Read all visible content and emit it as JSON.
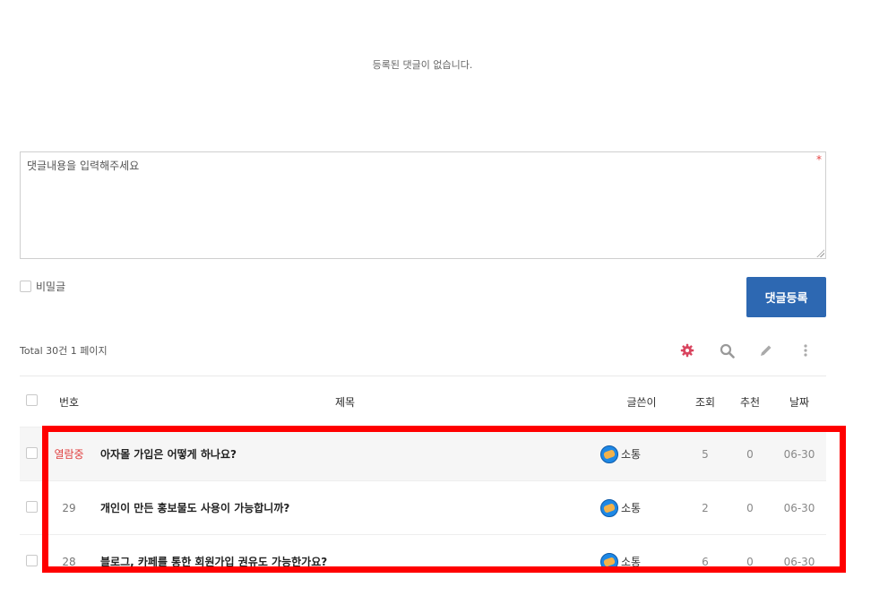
{
  "comments": {
    "empty_message": "등록된 댓글이 없습니다.",
    "input_placeholder": "댓글내용을 입력해주세요",
    "required_mark": "*",
    "secret_label": "비밀글",
    "submit_label": "댓글등록"
  },
  "board": {
    "total_text": "Total 30건 1 페이지",
    "toolbar_icons": [
      "gear-icon",
      "search-icon",
      "pencil-icon",
      "more-vertical-icon"
    ],
    "accent_color": "#d9455f",
    "columns": {
      "num": "번호",
      "title": "제목",
      "author": "글쓴이",
      "views": "조회",
      "recommend": "추천",
      "date": "날짜"
    },
    "rows": [
      {
        "num": "열람중",
        "title": "아자몰 가입은 어떻게 하나요?",
        "author": "소통",
        "views": "5",
        "recommend": "0",
        "date": "06-30"
      },
      {
        "num": "29",
        "title": "개인이 만든 홍보물도 사용이 가능합니까?",
        "author": "소통",
        "views": "2",
        "recommend": "0",
        "date": "06-30"
      },
      {
        "num": "28",
        "title": "블로그, 카페를 통한 회원가입 권유도 가능한가요?",
        "author": "소통",
        "views": "6",
        "recommend": "0",
        "date": "06-30"
      }
    ]
  },
  "highlight_color": "#ff0000"
}
